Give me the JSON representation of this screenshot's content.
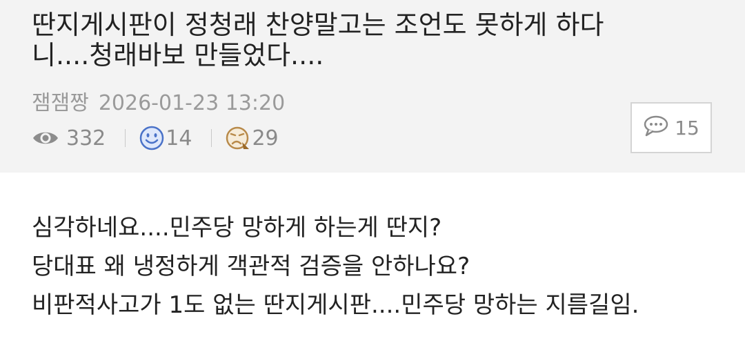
{
  "post": {
    "title": "딴지게시판이 정청래 찬양말고는 조언도 못하게 하다니....청래바보 만들었다....",
    "author": "잼잼짱",
    "datetime": "2026-01-23 13:20",
    "views": "332",
    "likes": "14",
    "dislikes": "29",
    "comments": "15"
  },
  "icons": {
    "views": "eye-icon",
    "likes": "smile-icon",
    "dislikes": "frown-icon",
    "comments": "chat-bubble-icon"
  },
  "colors": {
    "header_bg": "#f3f3f3",
    "like_blue": "#4a72c8",
    "dislike_brown": "#b88a4a"
  },
  "body": {
    "lines": [
      "심각하네요....민주당 망하게 하는게 딴지?",
      "당대표 왜 냉정하게 객관적 검증을 안하나요?",
      "비판적사고가 1도 없는 딴지게시판....민주당 망하는 지름길임."
    ]
  }
}
